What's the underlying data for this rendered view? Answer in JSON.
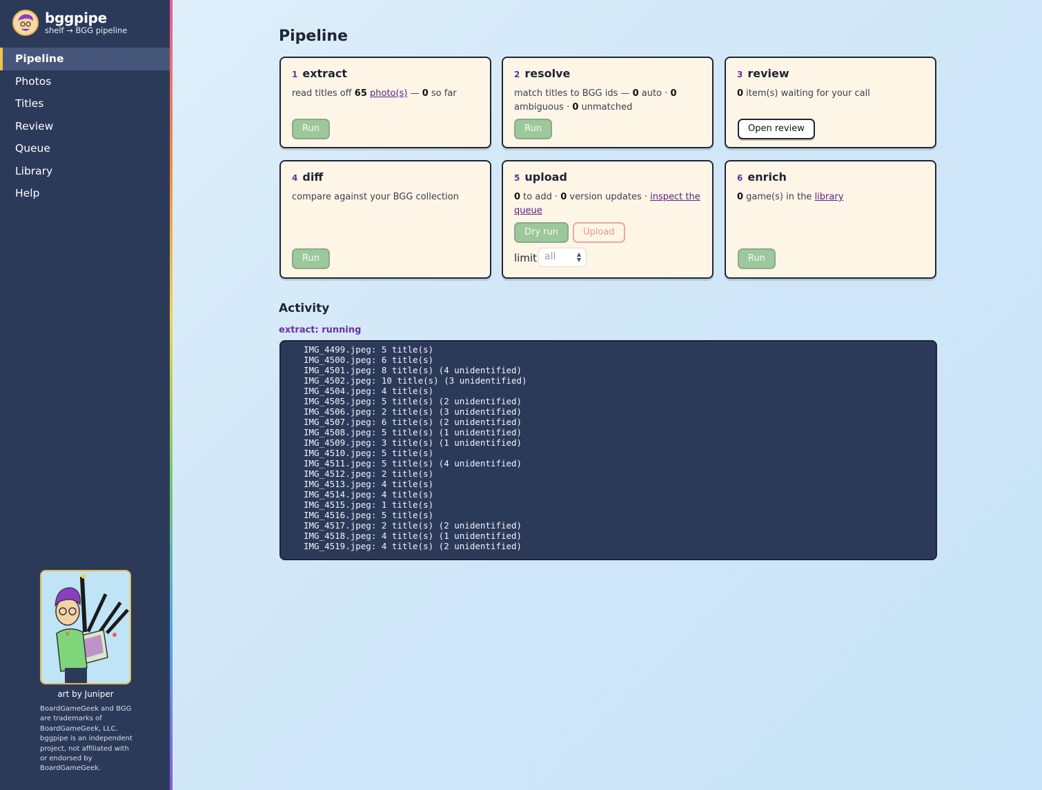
{
  "brand": {
    "name": "bggpipe",
    "subtitle": "shelf → BGG pipeline"
  },
  "nav": [
    {
      "label": "Pipeline",
      "active": true
    },
    {
      "label": "Photos"
    },
    {
      "label": "Titles"
    },
    {
      "label": "Review"
    },
    {
      "label": "Queue"
    },
    {
      "label": "Library"
    },
    {
      "label": "Help"
    }
  ],
  "sidebar_footer": {
    "art_credit": "art by Juniper",
    "trademark": "BoardGameGeek and BGG are trademarks of BoardGameGeek, LLC. bggpipe is an independent project, not affiliated with or endorsed by BoardGameGeek."
  },
  "page_title": "Pipeline",
  "steps": {
    "extract": {
      "num": "1",
      "title": "extract",
      "t1": "read titles off ",
      "photos_count": "65",
      "photos_link": "photo(s)",
      "t2": " — ",
      "so_far_count": "0",
      "t3": " so far",
      "run_label": "Run"
    },
    "resolve": {
      "num": "2",
      "title": "resolve",
      "t1": "match titles to BGG ids — ",
      "auto_count": "0",
      "t2": " auto · ",
      "ambiguous_count": "0",
      "t3": " ambiguous · ",
      "unmatched_count": "0",
      "t4": " unmatched",
      "run_label": "Run"
    },
    "review": {
      "num": "3",
      "title": "review",
      "waiting_count": "0",
      "t1": " item(s) waiting for your call",
      "open_label": "Open review"
    },
    "diff": {
      "num": "4",
      "title": "diff",
      "description": "compare against your BGG collection",
      "run_label": "Run"
    },
    "upload": {
      "num": "5",
      "title": "upload",
      "add_count": "0",
      "t1": " to add · ",
      "version_count": "0",
      "t2": " version updates · ",
      "queue_link": "inspect the queue",
      "dry_run_label": "Dry run",
      "upload_label": "Upload",
      "limit_label": "limit",
      "limit_placeholder": "all"
    },
    "enrich": {
      "num": "6",
      "title": "enrich",
      "games_count": "0",
      "t1": " game(s) in the ",
      "library_link": "library",
      "run_label": "Run"
    }
  },
  "activity": {
    "title": "Activity",
    "status": "extract: running",
    "log": [
      "IMG_4499.jpeg: 5 title(s)",
      "IMG_4500.jpeg: 6 title(s)",
      "IMG_4501.jpeg: 8 title(s) (4 unidentified)",
      "IMG_4502.jpeg: 10 title(s) (3 unidentified)",
      "IMG_4504.jpeg: 4 title(s)",
      "IMG_4505.jpeg: 5 title(s) (2 unidentified)",
      "IMG_4506.jpeg: 2 title(s) (3 unidentified)",
      "IMG_4507.jpeg: 6 title(s) (2 unidentified)",
      "IMG_4508.jpeg: 5 title(s) (1 unidentified)",
      "IMG_4509.jpeg: 3 title(s) (1 unidentified)",
      "IMG_4510.jpeg: 5 title(s)",
      "IMG_4511.jpeg: 5 title(s) (4 unidentified)",
      "IMG_4512.jpeg: 2 title(s)",
      "IMG_4513.jpeg: 4 title(s)",
      "IMG_4514.jpeg: 4 title(s)",
      "IMG_4515.jpeg: 1 title(s)",
      "IMG_4516.jpeg: 5 title(s)",
      "IMG_4517.jpeg: 2 title(s) (2 unidentified)",
      "IMG_4518.jpeg: 4 title(s) (1 unidentified)",
      "IMG_4519.jpeg: 4 title(s) (2 unidentified)"
    ]
  },
  "colors": {
    "sidebar_bg": "#2c3a5a",
    "accent_purple": "#6a2fa0",
    "card_bg": "#fdf5e6",
    "run_green": "#9cc89c",
    "active_marker": "#f2c14e"
  }
}
